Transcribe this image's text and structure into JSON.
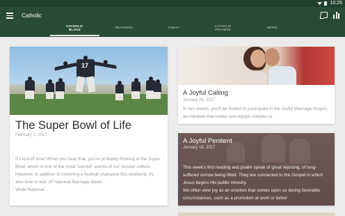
{
  "status_bar": {
    "time": "10:25",
    "icons": [
      "wifi-icon",
      "battery-icon"
    ]
  },
  "app_bar": {
    "title": "Catholic",
    "color": "#284a36",
    "icons": [
      "menu-icon",
      "cast-icon",
      "stats-icon"
    ]
  },
  "tabs": [
    {
      "label": "CATHOLIC\nBLOGS",
      "active": true
    },
    {
      "label": "FEATURES",
      "active": false
    },
    {
      "label": "TODAY",
      "active": false
    },
    {
      "label": "CATHOLIC\nPRAYERS",
      "active": false
    },
    {
      "label": "MORE",
      "active": false
    }
  ],
  "cards": {
    "main": {
      "title": "The Super Bowl of Life",
      "date": "February 2, 2017",
      "text": "It's kickoff time! When you hear that, you're probably thinking of the Super Bowl, which is one of the most \"sacred\" events of our secular culture. However, in addition to crowning a football champion this weekend, it's also time to kick off National Marriage Week.",
      "text_tail": "While National",
      "image": "football-players-photo"
    },
    "calling": {
      "title": "A Joyful Calling",
      "date": "January 26, 2017",
      "text": "In two weeks, you'll be invited to participate in the Joyful Marriage Project, an initiative that invites and equips couples to",
      "image": "couple-photo"
    },
    "penitent": {
      "title": "A Joyful Penitent",
      "date": "January 19, 2017",
      "text": "This week's first reading and psalm speak of great rejoicing, of long-suffered sorrow being lifted. They are connected to the Gospel in which Jesus begins His public ministry.",
      "text2": "We often view joy as an emotion that comes upon us during favorable circumstances, such as a promotion at work or better"
    }
  }
}
